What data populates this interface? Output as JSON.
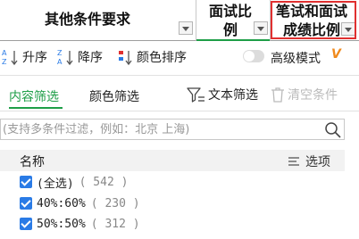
{
  "header": {
    "col1_title": "其他条件要求",
    "col2_title_line1": "面试比",
    "col2_title_line2": "例",
    "col3_title_line1": "笔试和面试",
    "col3_title_line2": "成绩比例"
  },
  "sort": {
    "asc_label": "升序",
    "desc_label": "降序",
    "color_sort_label": "颜色排序",
    "advanced_mode_label": "高级模式",
    "advanced_mode_on": false,
    "vip_mark": "V"
  },
  "tabs": {
    "content_filter": "内容筛选",
    "color_filter": "颜色筛选",
    "text_filter": "文本筛选",
    "clear_conditions": "清空条件"
  },
  "search": {
    "placeholder": "(支持多条件过滤，例如：北京 上海)"
  },
  "list": {
    "name_header": "名称",
    "options_label": "选项",
    "items": [
      {
        "label": "(全选)",
        "count": "( 542 )"
      },
      {
        "label": "40%:60%",
        "count": "( 230 )"
      },
      {
        "label": "50%:50%",
        "count": "( 312 )"
      }
    ]
  },
  "colors": {
    "accent_green": "#1e9e47",
    "highlight_red": "#e03030",
    "checkbox_blue": "#2a7be6",
    "vip_orange": "#f08a1c"
  }
}
